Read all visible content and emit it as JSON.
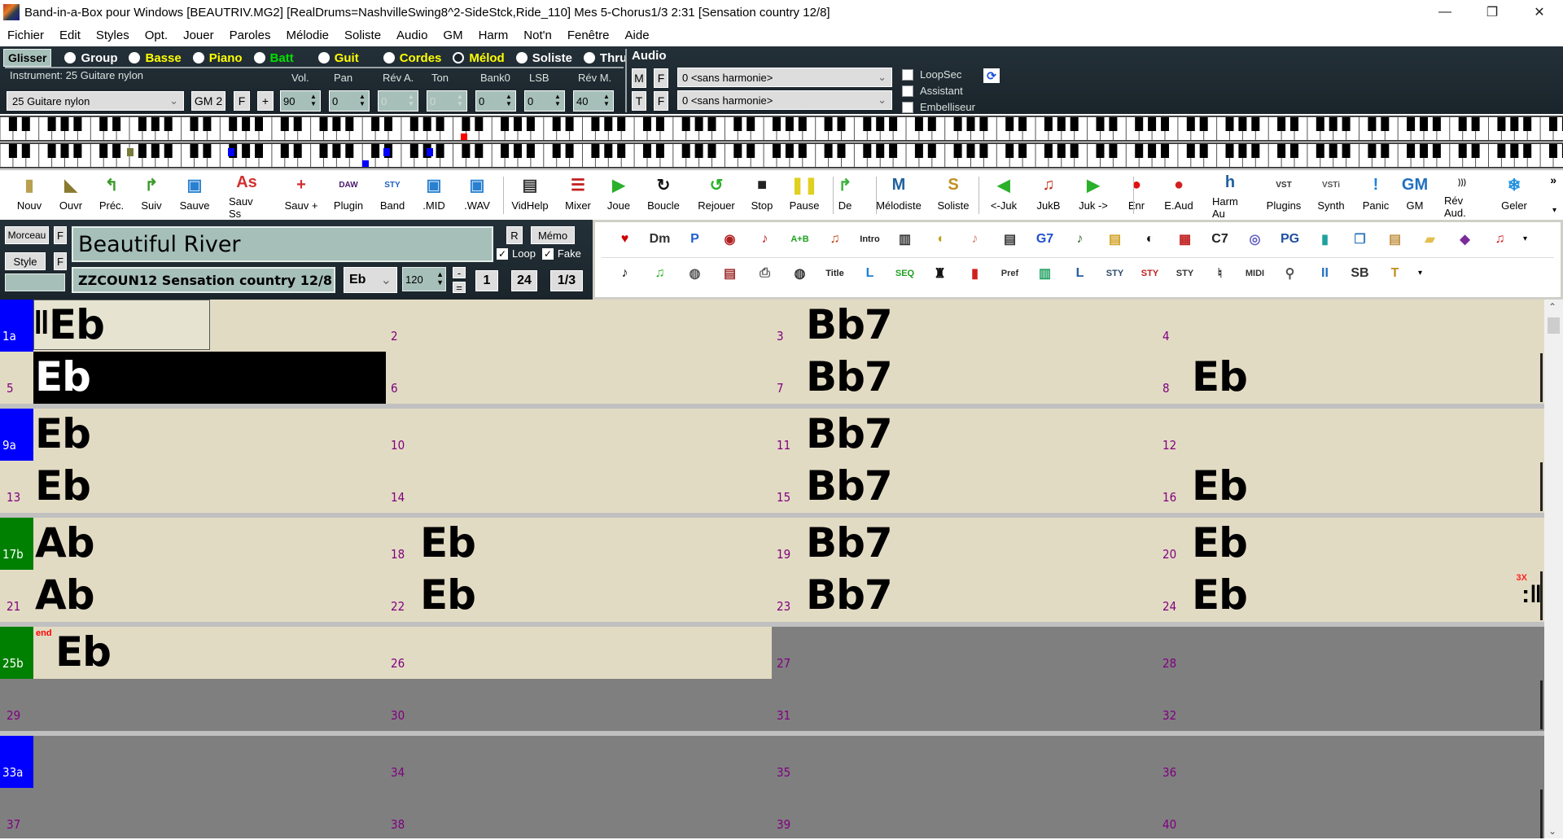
{
  "window": {
    "title": "Band-in-a-Box pour Windows  [BEAUTRIV.MG2] [RealDrums=NashvilleSwing8^2-SideStck,Ride_110] Mes 5-Chorus1/3   2:31  [Sensation country 12/8]",
    "minimize": "—",
    "restore": "❐",
    "close": "✕"
  },
  "menu": [
    "Fichier",
    "Edit",
    "Styles",
    "Opt.",
    "Jouer",
    "Paroles",
    "Mélodie",
    "Soliste",
    "Audio",
    "GM",
    "Harm",
    "Not'n",
    "Fenêtre",
    "Aide"
  ],
  "tracks": {
    "glisser": "Glisser",
    "items": [
      {
        "label": "Group",
        "color": "#ffffff",
        "selected": false
      },
      {
        "label": "Basse",
        "color": "#ffff00",
        "selected": false
      },
      {
        "label": "Piano",
        "color": "#ffff00",
        "selected": false
      },
      {
        "label": "Batt",
        "color": "#00e000",
        "selected": false
      },
      {
        "label": "Guit",
        "color": "#ffff00",
        "selected": false
      },
      {
        "label": "Cordes",
        "color": "#ffff00",
        "selected": false
      },
      {
        "label": "Mélod",
        "color": "#ffff00",
        "selected": true
      },
      {
        "label": "Soliste",
        "color": "#ffffff",
        "selected": false
      },
      {
        "label": "Thru",
        "color": "#ffffff",
        "selected": false
      }
    ]
  },
  "instrument": {
    "label": "Instrument: 25 Guitare nylon",
    "select": "25 Guitare nylon",
    "gm2": "GM 2",
    "f": "F",
    "plus": "+"
  },
  "mixer": {
    "labels": [
      "Vol.",
      "Pan",
      "Rév A.",
      "Ton",
      "Bank0",
      "LSB",
      "Rév M."
    ],
    "values": [
      "90",
      "0",
      "0",
      "0",
      "0",
      "0",
      "40"
    ],
    "disabled": [
      false,
      false,
      true,
      true,
      false,
      false,
      false
    ]
  },
  "audio": {
    "title": "Audio",
    "m": "M",
    "t": "T",
    "f": "F",
    "harmony1": "0 <sans harmonie>",
    "harmony2": "0 <sans harmonie>",
    "checks": [
      {
        "label": "LoopSec",
        "checked": false
      },
      {
        "label": "Assistant",
        "checked": false
      },
      {
        "label": "Embelliseur",
        "checked": false
      }
    ]
  },
  "toolbar": [
    {
      "label": "Nouv",
      "icon": "new-file-icon",
      "glyph": "▮",
      "color": "#b8a050"
    },
    {
      "label": "Ouvr",
      "icon": "open-folder-icon",
      "glyph": "◣",
      "color": "#8a7a30"
    },
    {
      "label": "Préc.",
      "icon": "previous-song-icon",
      "glyph": "↰",
      "color": "#3a9a2a"
    },
    {
      "label": "Suiv",
      "icon": "next-song-icon",
      "glyph": "↱",
      "color": "#3a9a2a"
    },
    {
      "label": "Sauve",
      "icon": "save-icon",
      "glyph": "▣",
      "color": "#2a80d0"
    },
    {
      "label": "Sauv Ss",
      "icon": "save-as-icon",
      "glyph": "As",
      "color": "#d03030"
    },
    {
      "label": "Sauv +",
      "icon": "save-plus-icon",
      "glyph": "+",
      "color": "#d03030"
    },
    {
      "label": "Plugin",
      "icon": "daw-plugin-icon",
      "glyph": "DAW",
      "color": "#4a1a6a"
    },
    {
      "label": "Band",
      "icon": "band-sty-icon",
      "glyph": "STY",
      "color": "#2060c0"
    },
    {
      "label": ".MID",
      "icon": "midi-save-icon",
      "glyph": "▣",
      "color": "#2a80d0"
    },
    {
      "label": ".WAV",
      "icon": "wav-save-icon",
      "glyph": "▣",
      "color": "#2a80d0"
    },
    {
      "label": "VidHelp",
      "icon": "video-help-icon",
      "glyph": "▤",
      "color": "#333"
    },
    {
      "label": "Mixer",
      "icon": "mixer-icon",
      "glyph": "☰",
      "color": "#c02020"
    },
    {
      "label": "Joue",
      "icon": "play-icon",
      "glyph": "▶",
      "color": "#2ab02a"
    },
    {
      "label": "Boucle",
      "icon": "loop-icon",
      "glyph": "↻",
      "color": "#111"
    },
    {
      "label": "Rejouer",
      "icon": "replay-icon",
      "glyph": "↺",
      "color": "#2ab02a"
    },
    {
      "label": "Stop",
      "icon": "stop-icon",
      "glyph": "■",
      "color": "#222"
    },
    {
      "label": "Pause",
      "icon": "pause-icon",
      "glyph": "❚❚",
      "color": "#e0d020"
    },
    {
      "label": "De",
      "icon": "from-icon",
      "glyph": "↱",
      "color": "#3ab03a"
    },
    {
      "label": "Mélodiste",
      "icon": "melodist-icon",
      "glyph": "M",
      "color": "#2060a0"
    },
    {
      "label": "Soliste",
      "icon": "soloist-icon",
      "glyph": "S",
      "color": "#c09020"
    },
    {
      "label": "<-Juk",
      "icon": "jukebox-prev-icon",
      "glyph": "◀",
      "color": "#2ab02a"
    },
    {
      "label": "JukB",
      "icon": "jukebox-icon",
      "glyph": "♫",
      "color": "#c03020"
    },
    {
      "label": "Juk ->",
      "icon": "jukebox-next-icon",
      "glyph": "▶",
      "color": "#2ab02a"
    },
    {
      "label": "Enr",
      "icon": "record-icon",
      "glyph": "●",
      "color": "#e01010"
    },
    {
      "label": "E.Aud",
      "icon": "record-audio-icon",
      "glyph": "●",
      "color": "#d02020"
    },
    {
      "label": "Harm Au",
      "icon": "audio-harmony-icon",
      "glyph": "h",
      "color": "#2060a0"
    },
    {
      "label": "Plugins",
      "icon": "plugins-icon",
      "glyph": "VST",
      "color": "#333"
    },
    {
      "label": "Synth",
      "icon": "synth-icon",
      "glyph": "VSTi",
      "color": "#555"
    },
    {
      "label": "Panic",
      "icon": "panic-icon",
      "glyph": "!",
      "color": "#2080e0"
    },
    {
      "label": "GM",
      "icon": "gm-icon",
      "glyph": "GM",
      "color": "#2070c0"
    },
    {
      "label": "Rév Aud.",
      "icon": "reverb-audio-icon",
      "glyph": ")))",
      "color": "#333"
    },
    {
      "label": "Geler",
      "icon": "freeze-icon",
      "glyph": "❄",
      "color": "#2090e0"
    }
  ],
  "toolbar_more": "»",
  "song": {
    "morceau": "Morceau",
    "style_btn": "Style",
    "f": "F",
    "title": "Beautiful River",
    "style": "ZZCOUN12 Sensation country 12/8",
    "r": "R",
    "memo": "Mémo",
    "loop": {
      "label": "Loop",
      "checked": true
    },
    "fake": {
      "label": "Fake",
      "checked": true
    },
    "key": "Eb",
    "tempo": "120",
    "minus": "-",
    "equals": "=",
    "start_bar": "1",
    "end_bar": "24",
    "choruses": "1/3"
  },
  "icon_row1": [
    {
      "name": "favorites-folder-icon",
      "glyph": "♥",
      "color": "#c00"
    },
    {
      "name": "drum-dm-icon",
      "glyph": "Dm",
      "color": "#333"
    },
    {
      "name": "p-window-icon",
      "glyph": "P",
      "color": "#2060d0"
    },
    {
      "name": "audio-disc-icon",
      "glyph": "◉",
      "color": "#b02020"
    },
    {
      "name": "sax-audio-icon",
      "glyph": "♪",
      "color": "#c02020"
    },
    {
      "name": "a-plus-b-icon",
      "glyph": "A+B",
      "color": "#20a020"
    },
    {
      "name": "guitar-icon",
      "glyph": "♫",
      "color": "#c04010"
    },
    {
      "name": "intro-icon",
      "glyph": "Intro",
      "color": "#222"
    },
    {
      "name": "piano-keys-icon",
      "glyph": "▥",
      "color": "#333"
    },
    {
      "name": "speaker-icon",
      "glyph": "◖",
      "color": "#c0a020"
    },
    {
      "name": "ear-icon",
      "glyph": "♪",
      "color": "#d08070"
    },
    {
      "name": "audio-track-icon",
      "glyph": "▤",
      "color": "#333"
    },
    {
      "name": "notes-g7-icon",
      "glyph": "G7",
      "color": "#2050d0"
    },
    {
      "name": "notation-icon",
      "glyph": "♪",
      "color": "#3a6a2a"
    },
    {
      "name": "cabinet-icon",
      "glyph": "▤",
      "color": "#d0a020"
    },
    {
      "name": "singer-icon",
      "glyph": "◐",
      "color": "#111"
    },
    {
      "name": "grid-icon",
      "glyph": "▦",
      "color": "#c02020"
    },
    {
      "name": "c7-chord-icon",
      "glyph": "C7",
      "color": "#222"
    },
    {
      "name": "cd-edit-icon",
      "glyph": "◎",
      "color": "#6060c0"
    },
    {
      "name": "pg-globe-icon",
      "glyph": "PG",
      "color": "#2050a0"
    },
    {
      "name": "mixer-speaker-icon",
      "glyph": "▮",
      "color": "#20a0a0"
    },
    {
      "name": "copy-icon",
      "glyph": "❐",
      "color": "#4080c0"
    },
    {
      "name": "paste-icon",
      "glyph": "▤",
      "color": "#c09040"
    },
    {
      "name": "folder-icon",
      "glyph": "▰",
      "color": "#e0c050"
    },
    {
      "name": "ufo-icon",
      "glyph": "◆",
      "color": "#7a2a9a"
    },
    {
      "name": "notes-colored-icon",
      "glyph": "♫",
      "color": "#d02020"
    }
  ],
  "icon_row2": [
    {
      "name": "eighth-note-icon",
      "glyph": "♪",
      "color": "#111"
    },
    {
      "name": "green-note-icon",
      "glyph": "♫",
      "color": "#20b020"
    },
    {
      "name": "tube-icon",
      "glyph": "◍",
      "color": "#555"
    },
    {
      "name": "audio-file-icon",
      "glyph": "▤",
      "color": "#a03030"
    },
    {
      "name": "printer-icon",
      "glyph": "⎙",
      "color": "#555"
    },
    {
      "name": "drum-icon",
      "glyph": "◍",
      "color": "#333"
    },
    {
      "name": "title-arrow-icon",
      "glyph": "Title",
      "color": "#222"
    },
    {
      "name": "lyrics-l-icon",
      "glyph": "L",
      "color": "#2080d0"
    },
    {
      "name": "seq-icon",
      "glyph": "SEQ",
      "color": "#20a020"
    },
    {
      "name": "conductor-icon",
      "glyph": "♜",
      "color": "#111"
    },
    {
      "name": "fader-speaker-icon",
      "glyph": "▮",
      "color": "#d02020"
    },
    {
      "name": "pref-icon",
      "glyph": "Pref",
      "color": "#333"
    },
    {
      "name": "meters-icon",
      "glyph": "▥",
      "color": "#20a060"
    },
    {
      "name": "lyrics-doc-icon",
      "glyph": "L",
      "color": "#2060a0"
    },
    {
      "name": "sty-hat-icon",
      "glyph": "STY",
      "color": "#2a4a6a"
    },
    {
      "name": "sty-pill-icon",
      "glyph": "STY",
      "color": "#c02020"
    },
    {
      "name": "sty-wand-icon",
      "glyph": "STY",
      "color": "#333"
    },
    {
      "name": "tuning-icon",
      "glyph": "♮",
      "color": "#333"
    },
    {
      "name": "midi-grid-icon",
      "glyph": "MIDI",
      "color": "#333"
    },
    {
      "name": "tuning-fork-icon",
      "glyph": "⚲",
      "color": "#555"
    },
    {
      "name": "pause-pillar-icon",
      "glyph": "II",
      "color": "#2070c0"
    },
    {
      "name": "sb-icon",
      "glyph": "SB",
      "color": "#333"
    },
    {
      "name": "t-tool-icon",
      "glyph": "T",
      "color": "#c09020"
    }
  ],
  "chord_sheet": {
    "rows": [
      {
        "measures": [
          {
            "num": "1a",
            "part": "a",
            "chord": "Eb",
            "repeat_start": true
          },
          {
            "num": "2",
            "chord": ""
          },
          {
            "num": "3",
            "chord": "Bb7"
          },
          {
            "num": "4",
            "chord": ""
          }
        ],
        "in_song": true
      },
      {
        "measures": [
          {
            "num": "5",
            "chord": "Eb",
            "selected": true
          },
          {
            "num": "6",
            "chord": ""
          },
          {
            "num": "7",
            "chord": "Bb7"
          },
          {
            "num": "8",
            "chord": "Eb"
          }
        ],
        "in_song": true
      },
      {
        "measures": [
          {
            "num": "9a",
            "part": "a",
            "chord": "Eb"
          },
          {
            "num": "10",
            "chord": ""
          },
          {
            "num": "11",
            "chord": "Bb7"
          },
          {
            "num": "12",
            "chord": ""
          }
        ],
        "in_song": true
      },
      {
        "measures": [
          {
            "num": "13",
            "chord": "Eb"
          },
          {
            "num": "14",
            "chord": ""
          },
          {
            "num": "15",
            "chord": "Bb7"
          },
          {
            "num": "16",
            "chord": "Eb"
          }
        ],
        "in_song": true
      },
      {
        "measures": [
          {
            "num": "17b",
            "part": "b",
            "chord": "Ab"
          },
          {
            "num": "18",
            "chord": "Eb"
          },
          {
            "num": "19",
            "chord": "Bb7"
          },
          {
            "num": "20",
            "chord": "Eb"
          }
        ],
        "in_song": true
      },
      {
        "measures": [
          {
            "num": "21",
            "chord": "Ab"
          },
          {
            "num": "22",
            "chord": "Eb"
          },
          {
            "num": "23",
            "chord": "Bb7"
          },
          {
            "num": "24",
            "chord": "Eb",
            "repeat_end": "3X"
          }
        ],
        "in_song": true
      },
      {
        "measures": [
          {
            "num": "25b",
            "part": "b",
            "chord": "Eb",
            "end_marker": "end"
          },
          {
            "num": "26",
            "chord": ""
          },
          {
            "num": "27",
            "chord": ""
          },
          {
            "num": "28",
            "chord": ""
          }
        ],
        "in_song": "half"
      },
      {
        "measures": [
          {
            "num": "29",
            "chord": ""
          },
          {
            "num": "30",
            "chord": ""
          },
          {
            "num": "31",
            "chord": ""
          },
          {
            "num": "32",
            "chord": ""
          }
        ],
        "in_song": false
      },
      {
        "measures": [
          {
            "num": "33a",
            "part": "a",
            "chord": ""
          },
          {
            "num": "34",
            "chord": ""
          },
          {
            "num": "35",
            "chord": ""
          },
          {
            "num": "36",
            "chord": ""
          }
        ],
        "in_song": false
      },
      {
        "measures": [
          {
            "num": "37",
            "chord": ""
          },
          {
            "num": "38",
            "chord": ""
          },
          {
            "num": "39",
            "chord": ""
          },
          {
            "num": "40",
            "chord": ""
          }
        ],
        "in_song": false
      }
    ],
    "part_colors": {
      "a": "#0000ff",
      "b": "#008000"
    }
  },
  "piano": {
    "upper_marks": [
      {
        "color": "#ff0000"
      }
    ],
    "lower_marks": [
      {
        "color": "#7a7a3a"
      },
      {
        "color": "#0000ff"
      },
      {
        "color": "#0000ff"
      },
      {
        "color": "#0000ff"
      },
      {
        "color": "#0000ff"
      }
    ]
  }
}
